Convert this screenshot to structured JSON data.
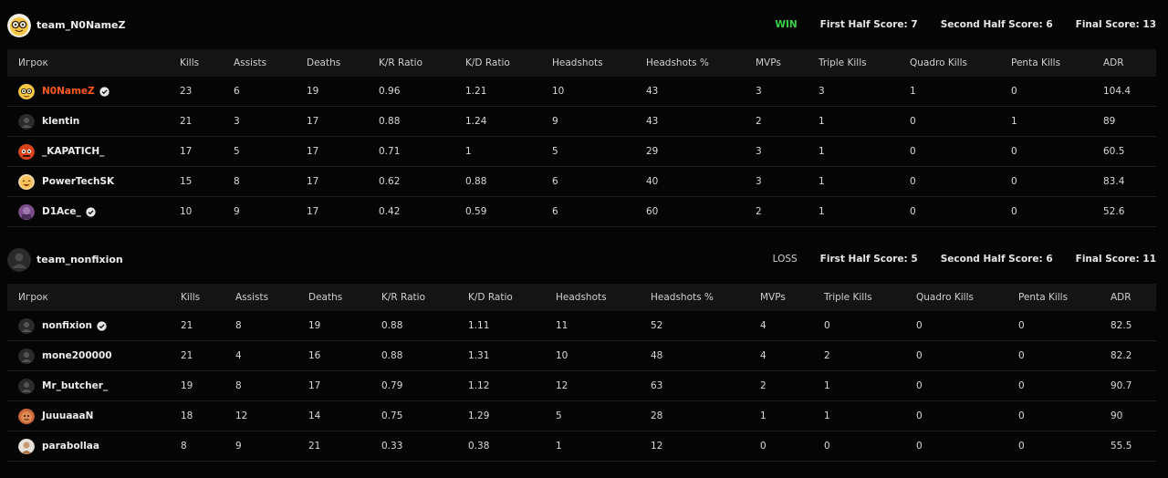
{
  "columns": [
    "Игрок",
    "Kills",
    "Assists",
    "Deaths",
    "K/R Ratio",
    "K/D Ratio",
    "Headshots",
    "Headshots %",
    "MVPs",
    "Triple Kills",
    "Quadro Kills",
    "Penta Kills",
    "ADR"
  ],
  "teams": [
    {
      "name": "team_N0NameZ",
      "result": "WIN",
      "first_half": "First Half Score: 7",
      "second_half": "Second Half Score: 6",
      "final": "Final Score: 13",
      "players": [
        {
          "name": "N0NameZ",
          "verified": true,
          "highlight": true,
          "avatar": "nerd-emoji-avatar",
          "stats": [
            "23",
            "6",
            "19",
            "0.96",
            "1.21",
            "10",
            "43",
            "3",
            "3",
            "1",
            "0",
            "104.4"
          ]
        },
        {
          "name": "klentin",
          "verified": false,
          "highlight": false,
          "avatar": "default-user-avatar",
          "stats": [
            "21",
            "3",
            "17",
            "0.88",
            "1.24",
            "9",
            "43",
            "2",
            "1",
            "0",
            "1",
            "89"
          ]
        },
        {
          "name": "_KAPATICH_",
          "verified": false,
          "highlight": false,
          "avatar": "red-character-avatar",
          "stats": [
            "17",
            "5",
            "17",
            "0.71",
            "1",
            "5",
            "29",
            "3",
            "1",
            "0",
            "0",
            "60.5"
          ]
        },
        {
          "name": "PowerTechSK",
          "verified": false,
          "highlight": false,
          "avatar": "smile-emoji-avatar",
          "stats": [
            "15",
            "8",
            "17",
            "0.62",
            "0.88",
            "6",
            "40",
            "3",
            "1",
            "0",
            "0",
            "83.4"
          ]
        },
        {
          "name": "D1Ace_",
          "verified": true,
          "highlight": false,
          "avatar": "purple-character-avatar",
          "stats": [
            "10",
            "9",
            "17",
            "0.42",
            "0.59",
            "6",
            "60",
            "2",
            "1",
            "0",
            "0",
            "52.6"
          ]
        }
      ]
    },
    {
      "name": "team_nonfixion",
      "result": "LOSS",
      "first_half": "First Half Score: 5",
      "second_half": "Second Half Score: 6",
      "final": "Final Score: 11",
      "players": [
        {
          "name": "nonfixion",
          "verified": true,
          "highlight": false,
          "avatar": "default-user-avatar",
          "stats": [
            "21",
            "8",
            "19",
            "0.88",
            "1.11",
            "11",
            "52",
            "4",
            "0",
            "0",
            "0",
            "82.5"
          ]
        },
        {
          "name": "mone200000",
          "verified": false,
          "highlight": false,
          "avatar": "default-user-avatar",
          "stats": [
            "21",
            "4",
            "16",
            "0.88",
            "1.31",
            "10",
            "48",
            "4",
            "2",
            "0",
            "0",
            "82.2"
          ]
        },
        {
          "name": "Mr_butcher_",
          "verified": false,
          "highlight": false,
          "avatar": "default-user-avatar",
          "stats": [
            "19",
            "8",
            "17",
            "0.79",
            "1.12",
            "12",
            "63",
            "2",
            "1",
            "0",
            "0",
            "90.7"
          ]
        },
        {
          "name": "JuuuaaaN",
          "verified": false,
          "highlight": false,
          "avatar": "orange-character-avatar",
          "stats": [
            "18",
            "12",
            "14",
            "0.75",
            "1.29",
            "5",
            "28",
            "1",
            "1",
            "0",
            "0",
            "90"
          ]
        },
        {
          "name": "parabollaa",
          "verified": false,
          "highlight": false,
          "avatar": "photo-avatar",
          "stats": [
            "8",
            "9",
            "21",
            "0.33",
            "0.38",
            "1",
            "12",
            "0",
            "0",
            "0",
            "0",
            "55.5"
          ]
        }
      ]
    }
  ]
}
